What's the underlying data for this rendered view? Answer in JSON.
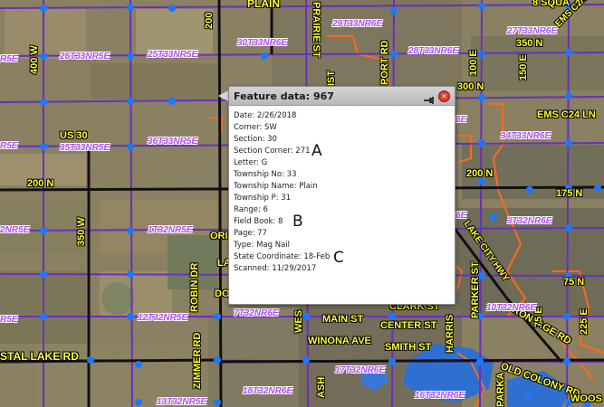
{
  "popup": {
    "title": "Feature data: 967",
    "rows": [
      "Date: 2/26/2018",
      "Corner: SW",
      "Section: 30",
      "Section Corner: 271",
      "Letter: G",
      "Township No: 33",
      "Township Name: Plain",
      "Township P: 31",
      "Range: 6",
      "Field Book: 8",
      "Page: 77",
      "Type: Mag Nail",
      "State Coordinate: 18-Feb",
      "Scanned: 11/29/2017"
    ],
    "annotations": {
      "a": "A",
      "b": "B",
      "c": "C"
    }
  },
  "map": {
    "road_labels": {
      "plain": "PLAIN",
      "w400": "400 W",
      "us30": "US 30",
      "n200_left": "200 N",
      "w350": "350 W",
      "crystal_lake": "STAL LAKE RD",
      "w200": "200",
      "prairie": "PRAIRIE ST",
      "port_rd": "PORT RD",
      "e100": "100 E",
      "e150": "150 E",
      "n350": "350 N",
      "n300": "300 N",
      "ems_c21": "EMS C2/C LN",
      "ems_c24": "EMS C24 LN",
      "n200_right": "200 N",
      "n175": "175 N",
      "sq": "8 SQUA",
      "lake_city": "LAKE CITY HWY",
      "parker": "PARKER ST",
      "n75": "75 N",
      "frontage": "FRONTAGE RD",
      "e225": "225 E",
      "clark": "CLARK ST",
      "main": "MAIN ST",
      "center": "CENTER ST",
      "winona": "WINONA AVE",
      "smith": "SMITH ST",
      "old_colony": "OLD COLONY RD",
      "woos": "WOOS",
      "robin": "ROBIN DR",
      "zimmer": "ZIMMER RD",
      "wes": "WES",
      "harris": "HARRIS",
      "ori": "ORI",
      "lam": "LA",
      "do": "DO",
      "ash": "ASH",
      "parkr": "PARKA",
      "e75": "75 E",
      "ist": "IST",
      "ne6": "6E"
    },
    "township_labels": {
      "t30": "30T33NR6E",
      "t29": "29T33NR6E",
      "t28": "28T33NR6E",
      "t27": "27T33NR6E",
      "t26": "26T33NR5E",
      "t25": "25T33NR5E",
      "t35": "35T33NR5E",
      "t36": "36T33NR5E",
      "t34": "34T33NR6E",
      "t1": "1T32NR5E",
      "t3": "3T32NR6E",
      "t10": "10T32NR6E",
      "t7": "7T32NR6E",
      "t12": "12T32NR5E",
      "t13": "13T32NR5E",
      "t18": "18T32NR6E",
      "t17": "17T32NR6E",
      "t16": "16T32NR6E",
      "t2nr": "2NR5E",
      "r5e": "R5E",
      "nr6e": "6E"
    }
  },
  "colors": {
    "section_line": "#6a2fc0",
    "corner_dot": "#1e78ff",
    "road_label": "#ffff33",
    "township_label": "#b24cff",
    "city_boundary": "#ff6a1a",
    "lake": "#2f6fd0"
  }
}
